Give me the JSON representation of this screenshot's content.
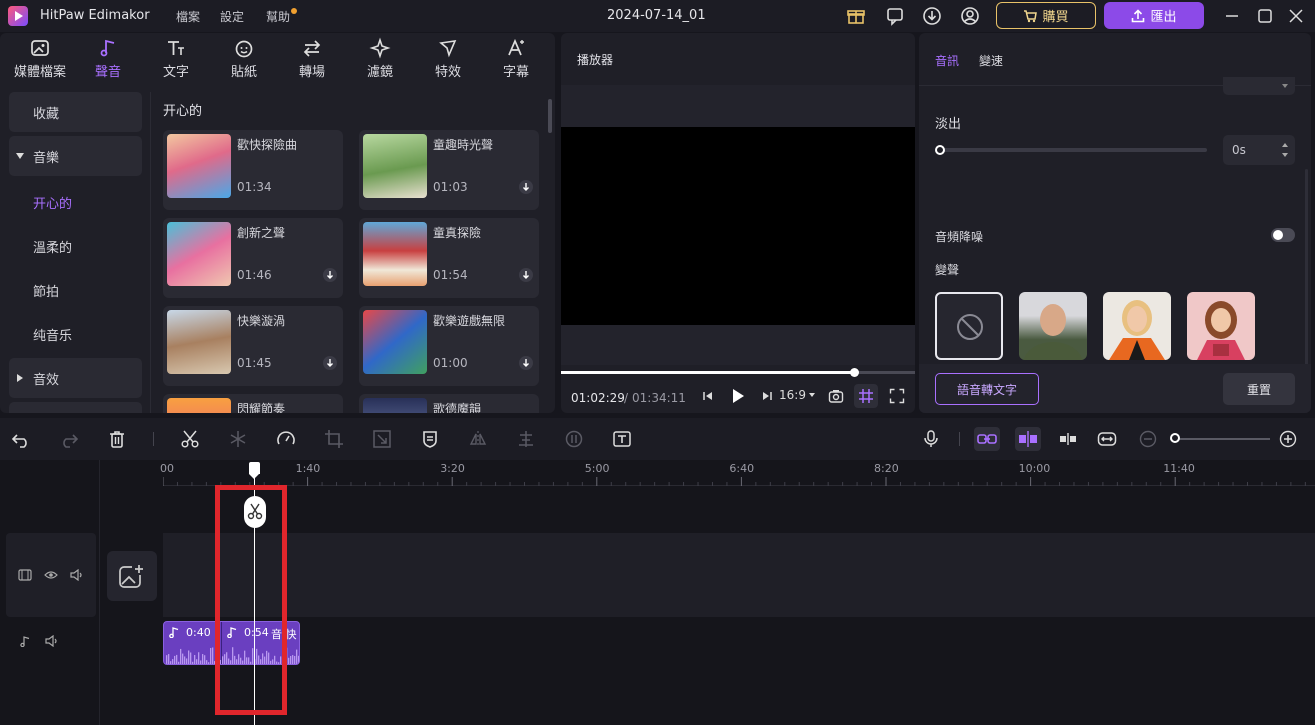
{
  "app": {
    "name": "HitPaw Edimakor",
    "project": "2024-07-14_01"
  },
  "menu": [
    "檔案",
    "設定",
    "幫助"
  ],
  "header": {
    "buy_label": "購買",
    "export_label": "匯出"
  },
  "toolbar": {
    "tools": [
      {
        "label": "媒體檔案",
        "icon": "media-icon"
      },
      {
        "label": "聲音",
        "icon": "music-note-icon",
        "active": true
      },
      {
        "label": "文字",
        "icon": "text-icon"
      },
      {
        "label": "貼紙",
        "icon": "sticker-icon"
      },
      {
        "label": "轉場",
        "icon": "transition-icon"
      },
      {
        "label": "濾鏡",
        "icon": "filter-icon"
      },
      {
        "label": "特效",
        "icon": "effect-icon"
      },
      {
        "label": "字幕",
        "icon": "subtitle-icon"
      }
    ]
  },
  "sidebar": {
    "favorites": "收藏",
    "music": "音樂",
    "sub_items": [
      "开心的",
      "溫柔的",
      "節拍",
      "纯音乐"
    ],
    "selected": "开心的",
    "sound_effects": "音效"
  },
  "library": {
    "section_title": "开心的",
    "tracks": [
      {
        "title": "歡快探險曲",
        "duration": "01:34",
        "downloadable": false
      },
      {
        "title": "童趣時光聲",
        "duration": "01:03",
        "downloadable": true
      },
      {
        "title": "創新之聲",
        "duration": "01:46",
        "downloadable": true
      },
      {
        "title": "童真探險",
        "duration": "01:54",
        "downloadable": true
      },
      {
        "title": "快樂漩渦",
        "duration": "01:45",
        "downloadable": true
      },
      {
        "title": "歡樂遊戲無限",
        "duration": "01:00",
        "downloadable": true
      },
      {
        "title": "閃耀節奏",
        "duration": "",
        "downloadable": false
      },
      {
        "title": "歌德魔韻",
        "duration": "",
        "downloadable": false
      }
    ]
  },
  "player": {
    "title": "播放器",
    "current_time": "01:02:29",
    "total_time": "01:34:11",
    "aspect": "16:9",
    "progress": 0.83
  },
  "properties": {
    "tabs": [
      "音訊",
      "變速"
    ],
    "active_tab": "音訊",
    "fade_out_label": "淡出",
    "fade_out_value": "0s",
    "denoise_label": "音頻降噪",
    "denoise_on": false,
    "voice_change_label": "變聲",
    "speech_to_text_label": "語音轉文字",
    "reset_label": "重置"
  },
  "timeline": {
    "ruler_labels": [
      "00",
      "1:40",
      "3:20",
      "5:00",
      "6:40",
      "8:20",
      "10:00",
      "11:40"
    ],
    "clips": [
      {
        "time": "0:40",
        "name": ""
      },
      {
        "time": "0:54",
        "name": "音 快"
      }
    ],
    "zoom_level": 0.05
  },
  "colors": {
    "accent": "#a970ff",
    "export": "#8c4ae8",
    "buy": "#e8c268",
    "clip": "#6a3fc0",
    "highlight": "#e0262c"
  }
}
